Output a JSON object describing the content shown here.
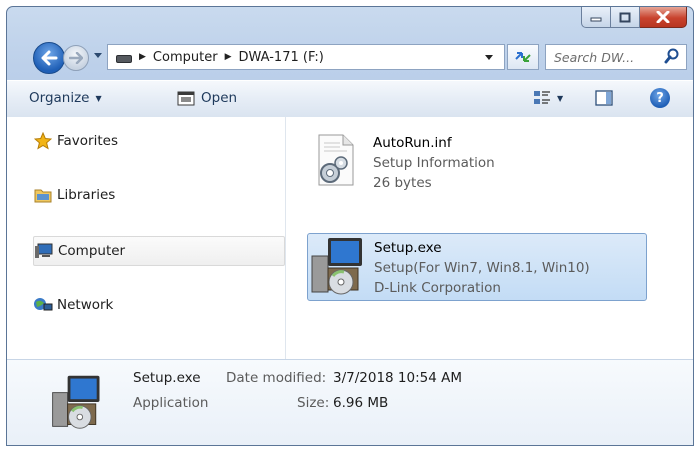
{
  "window": {
    "caption": {
      "minimize_icon": "minimize-icon",
      "maximize_icon": "maximize-icon",
      "close_icon": "close-icon"
    }
  },
  "nav": {
    "breadcrumbs": [
      "Computer",
      "DWA-171 (F:)"
    ],
    "search_placeholder": "Search DW..."
  },
  "toolbar": {
    "organize_label": "Organize",
    "open_label": "Open"
  },
  "sidebar": {
    "items": [
      {
        "label": "Favorites",
        "icon": "star-icon"
      },
      {
        "label": "Libraries",
        "icon": "library-icon"
      },
      {
        "label": "Computer",
        "icon": "computer-icon"
      },
      {
        "label": "Network",
        "icon": "network-icon"
      }
    ]
  },
  "files": [
    {
      "name": "AutoRun.inf",
      "line2": "Setup Information",
      "line3": "26 bytes",
      "icon": "settings-file-icon"
    },
    {
      "name": "Setup.exe",
      "line2": "Setup(For Win7, Win8.1, Win10)",
      "line3": "D-Link Corporation",
      "icon": "installer-icon"
    }
  ],
  "details": {
    "name": "Setup.exe",
    "type": "Application",
    "modified_label": "Date modified:",
    "modified_value": "3/7/2018 10:54 AM",
    "size_label": "Size:",
    "size_value": "6.96 MB"
  }
}
